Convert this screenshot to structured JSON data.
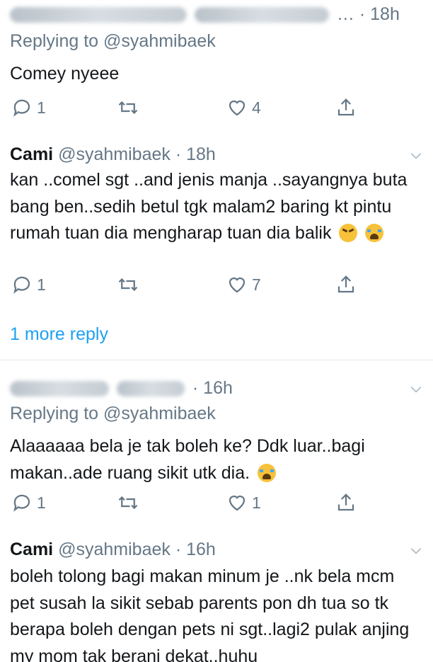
{
  "tweets": [
    {
      "time": "18h",
      "ellipsis": "…",
      "reply_prefix": "Replying to",
      "reply_handle": "@syahmibaek",
      "text": "Comey nyeee",
      "reply_count": "1",
      "retweet_count": "",
      "like_count": "4"
    },
    {
      "name": "Cami",
      "handle": "@syahmibaek",
      "time": "· 18h",
      "text": "kan ..comel sgt ..and jenis manja ..sayangnya buta bang ben..sedih betul tgk malam2 baring kt pintu rumah tuan dia mengharap tuan dia balik",
      "reply_count": "1",
      "like_count": "7",
      "more_replies": "1 more reply"
    },
    {
      "time": "· 16h",
      "reply_prefix": "Replying to",
      "reply_handle": "@syahmibaek",
      "text": "Alaaaaaa bela je tak boleh ke? Ddk luar..bagi makan..ade ruang sikit utk dia.",
      "reply_count": "1",
      "like_count": "1"
    },
    {
      "name": "Cami",
      "handle": "@syahmibaek",
      "time": "· 16h",
      "text": "boleh tolong bagi makan minum je ..nk bela mcm pet susah la sikit sebab parents pon dh tua so tk berapa boleh dengan pets ni sgt..lagi2 pulak anjing my mom tak berani dekat..huhu"
    }
  ],
  "icons": {
    "reply": "reply-icon",
    "retweet": "retweet-icon",
    "like": "heart-icon",
    "share": "share-icon",
    "more": "chevron-down-icon"
  },
  "colors": {
    "text": "#14171a",
    "secondary": "#657786",
    "link": "#1da1f2",
    "divider": "#e1e8ed"
  }
}
